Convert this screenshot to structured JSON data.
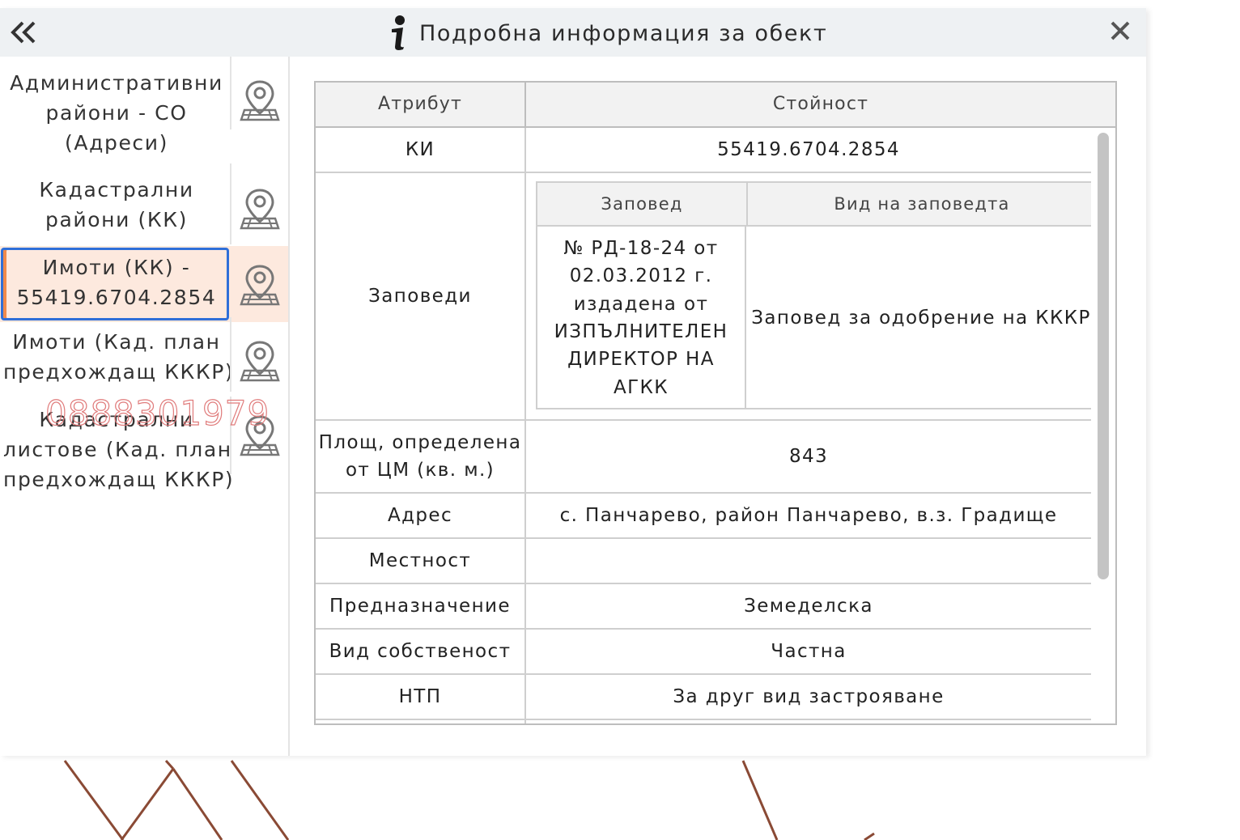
{
  "header": {
    "title": "Подробна информация за обект",
    "collapse_icon": "double-chevron-left-icon",
    "info_icon": "info-icon",
    "close_icon": "close-icon"
  },
  "sidebar": {
    "items": [
      {
        "lines": [
          "Административни",
          "райони - СО",
          "(Адреси)"
        ],
        "selected": false,
        "icon": "map-pin-icon"
      },
      {
        "lines": [
          "Кадастрални",
          "райони (КК)"
        ],
        "selected": false,
        "icon": "map-pin-icon"
      },
      {
        "lines": [
          "Имоти (КК) -",
          "55419.6704.2854"
        ],
        "selected": true,
        "icon": "map-pin-icon"
      },
      {
        "lines": [
          "Имоти (Кад. план",
          "предхождащ КККР)"
        ],
        "selected": false,
        "icon": "map-pin-icon"
      },
      {
        "lines": [
          "Кадастрални",
          "листове (Кад. план",
          "предхождащ КККР)"
        ],
        "selected": false,
        "icon": "map-pin-icon"
      }
    ]
  },
  "watermark": "0888301979",
  "table": {
    "headers": [
      "Атрибут",
      "Стойност"
    ],
    "rows": [
      {
        "attr": "КИ",
        "value": "55419.6704.2854"
      },
      {
        "attr": "Заповеди",
        "nested": {
          "headers": [
            "Заповед",
            "Вид на заповедта"
          ],
          "row": {
            "order_lines": [
              "№ РД-18-24 от",
              "02.03.2012 г.",
              "издадена от",
              "ИЗПЪЛНИТЕЛЕН",
              "ДИРЕКТОР НА",
              "АГКК"
            ],
            "type": "Заповед за одобрение на КККР"
          }
        }
      },
      {
        "attr_lines": [
          "Площ, определена",
          "от ЦМ (кв. м.)"
        ],
        "value": "843"
      },
      {
        "attr": "Адрес",
        "value": "с. Панчарево, район Панчарево, в.з. Градище"
      },
      {
        "attr": "Местност",
        "value": ""
      },
      {
        "attr": "Предназначение",
        "value": "Земеделска"
      },
      {
        "attr": "Вид собственост",
        "value": "Частна"
      },
      {
        "attr": "НТП",
        "value": "За друг вид застрояване"
      }
    ]
  },
  "colors": {
    "header_bg": "#eef1f3",
    "selected_bg": "#fde9de",
    "selected_border": "#2f6fd8",
    "selected_accent": "#f08a4b",
    "map_line": "#8a4a35"
  }
}
